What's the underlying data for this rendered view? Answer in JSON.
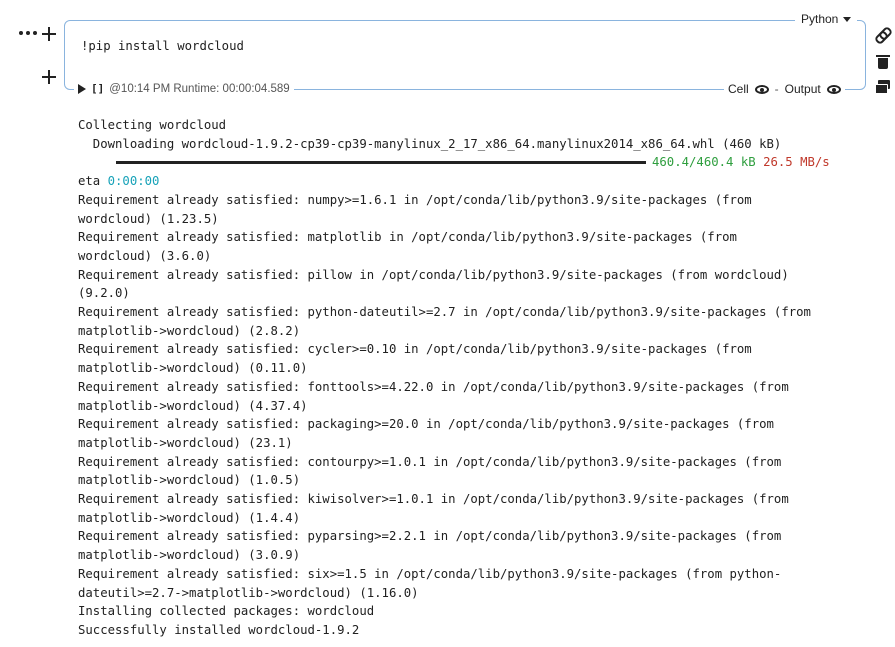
{
  "cell": {
    "language": "Python",
    "code": "!pip install wordcloud",
    "run_bracket": "[]",
    "run_info": "@10:14 PM Runtime: 00:00:04.589",
    "cell_label": "Cell",
    "output_label": "Output",
    "separator": "-"
  },
  "icons": {
    "more": "more-options-icon",
    "add": "add-cell-icon",
    "run": "play-icon",
    "link": "link-icon",
    "trash": "trash-icon",
    "comment": "comment-icon",
    "visibility": "eye-icon"
  },
  "output": {
    "collecting": "Collecting wordcloud",
    "downloading": "  Downloading wordcloud-1.9.2-cp39-cp39-manylinux_2_17_x86_64.manylinux2014_x86_64.whl (460 kB)",
    "progress_size": "460.4/460.4 kB",
    "progress_speed": "26.5 MB/s",
    "eta_label": "eta ",
    "eta_value": "0:00:00",
    "lines": [
      "Requirement already satisfied: numpy>=1.6.1 in /opt/conda/lib/python3.9/site-packages (from",
      "wordcloud) (1.23.5)",
      "Requirement already satisfied: matplotlib in /opt/conda/lib/python3.9/site-packages (from",
      "wordcloud) (3.6.0)",
      "Requirement already satisfied: pillow in /opt/conda/lib/python3.9/site-packages (from wordcloud)",
      "(9.2.0)",
      "Requirement already satisfied: python-dateutil>=2.7 in /opt/conda/lib/python3.9/site-packages (from",
      "matplotlib->wordcloud) (2.8.2)",
      "Requirement already satisfied: cycler>=0.10 in /opt/conda/lib/python3.9/site-packages (from",
      "matplotlib->wordcloud) (0.11.0)",
      "Requirement already satisfied: fonttools>=4.22.0 in /opt/conda/lib/python3.9/site-packages (from",
      "matplotlib->wordcloud) (4.37.4)",
      "Requirement already satisfied: packaging>=20.0 in /opt/conda/lib/python3.9/site-packages (from",
      "matplotlib->wordcloud) (23.1)",
      "Requirement already satisfied: contourpy>=1.0.1 in /opt/conda/lib/python3.9/site-packages (from",
      "matplotlib->wordcloud) (1.0.5)",
      "Requirement already satisfied: kiwisolver>=1.0.1 in /opt/conda/lib/python3.9/site-packages (from",
      "matplotlib->wordcloud) (1.4.4)",
      "Requirement already satisfied: pyparsing>=2.2.1 in /opt/conda/lib/python3.9/site-packages (from",
      "matplotlib->wordcloud) (3.0.9)",
      "Requirement already satisfied: six>=1.5 in /opt/conda/lib/python3.9/site-packages (from python-",
      "dateutil>=2.7->matplotlib->wordcloud) (1.16.0)",
      "Installing collected packages: wordcloud",
      "Successfully installed wordcloud-1.9.2"
    ]
  },
  "colors": {
    "cell_border": "#8ab4de",
    "progress_size": "#2e9e3e",
    "progress_speed": "#c0392b",
    "eta_value": "#17a2b8"
  }
}
